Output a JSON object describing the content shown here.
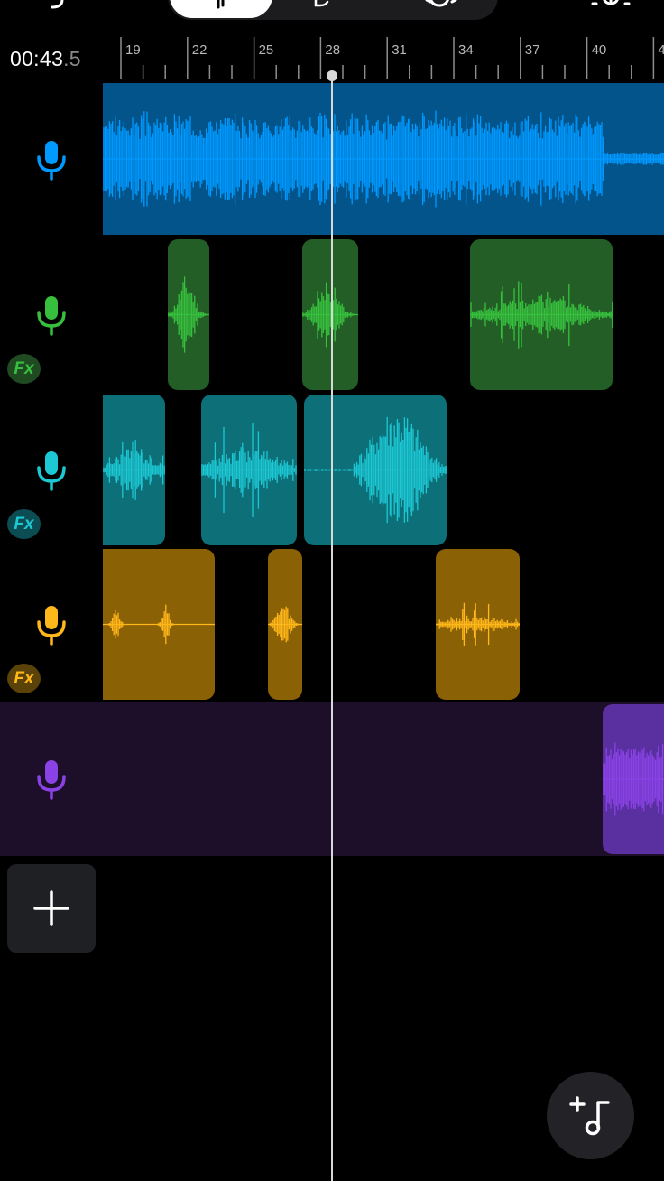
{
  "header": {
    "time_main": "00:43",
    "time_fraction": ".5"
  },
  "ruler": {
    "labels": [
      "19",
      "22",
      "25",
      "28",
      "31",
      "34",
      "37",
      "40",
      "4"
    ]
  },
  "tracks": [
    {
      "name": "track-1",
      "color": "#0099ff",
      "fx": false
    },
    {
      "name": "track-2",
      "color": "#37c03e",
      "fx": true
    },
    {
      "name": "track-3",
      "color": "#1cc8d4",
      "fx": true
    },
    {
      "name": "track-4",
      "color": "#ffb71a",
      "fx": true
    },
    {
      "name": "track-5",
      "color": "#8a42e6",
      "fx": false
    }
  ],
  "fx_label": "Fx",
  "icons": {
    "add_track": "plus-icon",
    "add_music": "add-music-icon",
    "record": "microphone-icon"
  }
}
